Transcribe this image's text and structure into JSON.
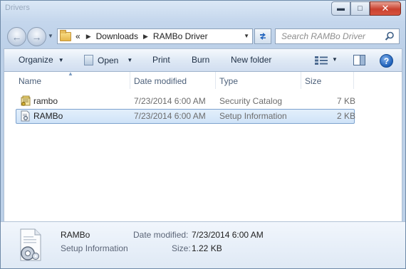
{
  "window": {
    "title": "Drivers"
  },
  "nav": {
    "history_marker": "«",
    "breadcrumb": [
      "Downloads",
      "RAMBo Driver"
    ],
    "search_placeholder": "Search RAMBo Driver"
  },
  "toolbar": {
    "organize": "Organize",
    "open": "Open",
    "print": "Print",
    "burn": "Burn",
    "new_folder": "New folder"
  },
  "columns": {
    "name": "Name",
    "date": "Date modified",
    "type": "Type",
    "size": "Size"
  },
  "files": [
    {
      "name": "rambo",
      "date": "7/23/2014 6:00 AM",
      "type": "Security Catalog",
      "size": "7 KB",
      "icon": "security-catalog-icon",
      "selected": false
    },
    {
      "name": "RAMBo",
      "date": "7/23/2014 6:00 AM",
      "type": "Setup Information",
      "size": "2 KB",
      "icon": "setup-info-icon",
      "selected": true
    }
  ],
  "details": {
    "name": "RAMBo",
    "type": "Setup Information",
    "date_label": "Date modified:",
    "date_value": "7/23/2014 6:00 AM",
    "size_label": "Size:",
    "size_value": "1.22 KB"
  },
  "colors": {
    "selection": "#cfe3f8",
    "selection_border": "#7da2ce",
    "close_button": "#c9412f",
    "help_blue": "#1d5fb8"
  }
}
